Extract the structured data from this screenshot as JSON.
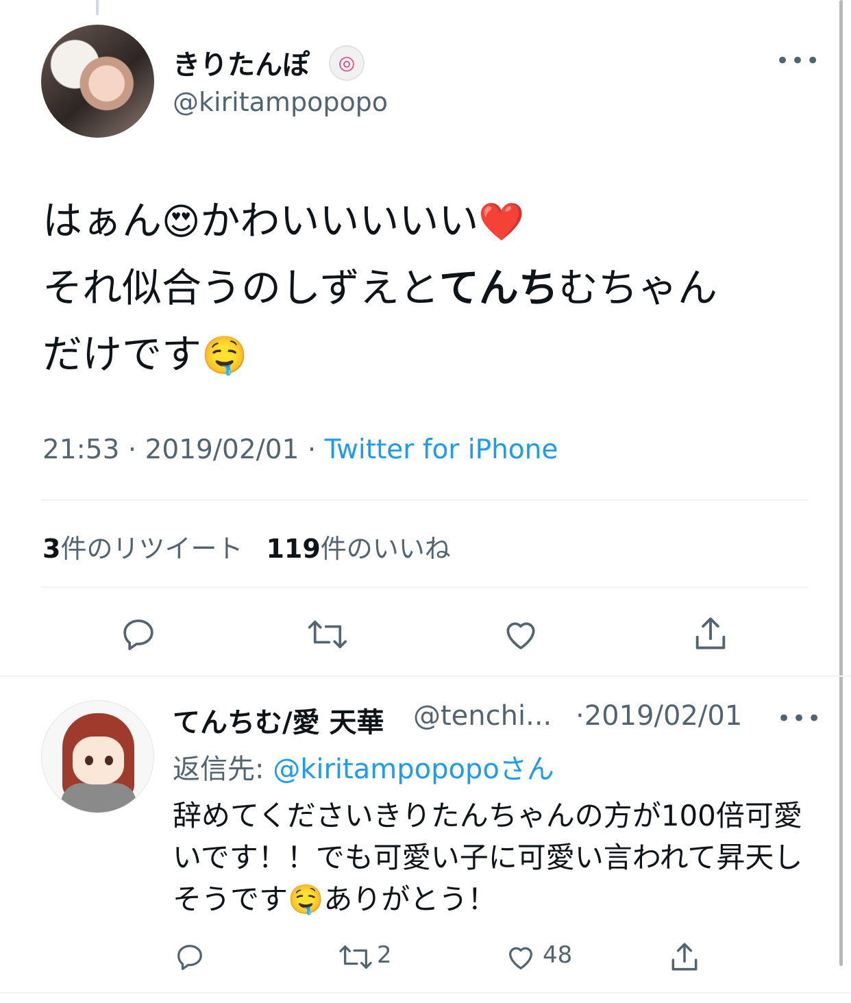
{
  "main_tweet": {
    "display_name": "きりたんぽ",
    "name_badge_icon": "naruto-icon",
    "handle": "@kiritampopopo",
    "text_line1_a": "はぁん",
    "emoji_heart_eyes": "😍",
    "text_line1_b": "かわいいいいい",
    "emoji_red_heart": "❤️",
    "text_line2_a": "それ似合うのしずえと",
    "text_line2_bold": "てんち",
    "text_line2_b": "むちゃん",
    "text_line3": "だけです",
    "emoji_drooling": "🤤",
    "time": "21:53",
    "date": "2019/02/01",
    "source": "Twitter for iPhone",
    "separator": " · ",
    "retweet_count": "3",
    "retweet_label": "件のリツイート",
    "like_count": "119",
    "like_label": "件のいいね"
  },
  "reply_tweet": {
    "display_name": "てんちむ/愛 天華",
    "handle": "@tenchi...",
    "time_separator": "·",
    "date": "2019/02/01",
    "reply_to_label": "返信先: ",
    "reply_to_mention": "@kiritampopopo",
    "reply_to_suffix": "さん",
    "text_part1": "辞めてくださいきりたんちゃんの方が100倍可愛いです！！でも可愛い子に可愛い言われて昇天しそうです",
    "emoji_drooling": "🤤",
    "text_part2": "ありがとう！",
    "retweet_count": "2",
    "like_count": "48"
  },
  "icons": {
    "more": "more-horizontal-icon",
    "reply": "reply-icon",
    "retweet": "retweet-icon",
    "like": "like-icon",
    "share": "share-icon"
  },
  "colors": {
    "link": "#1d9bf0",
    "secondary_text": "#536471",
    "primary_text": "#0f1419",
    "divider": "#eff3f4"
  },
  "more_dots": "•••"
}
